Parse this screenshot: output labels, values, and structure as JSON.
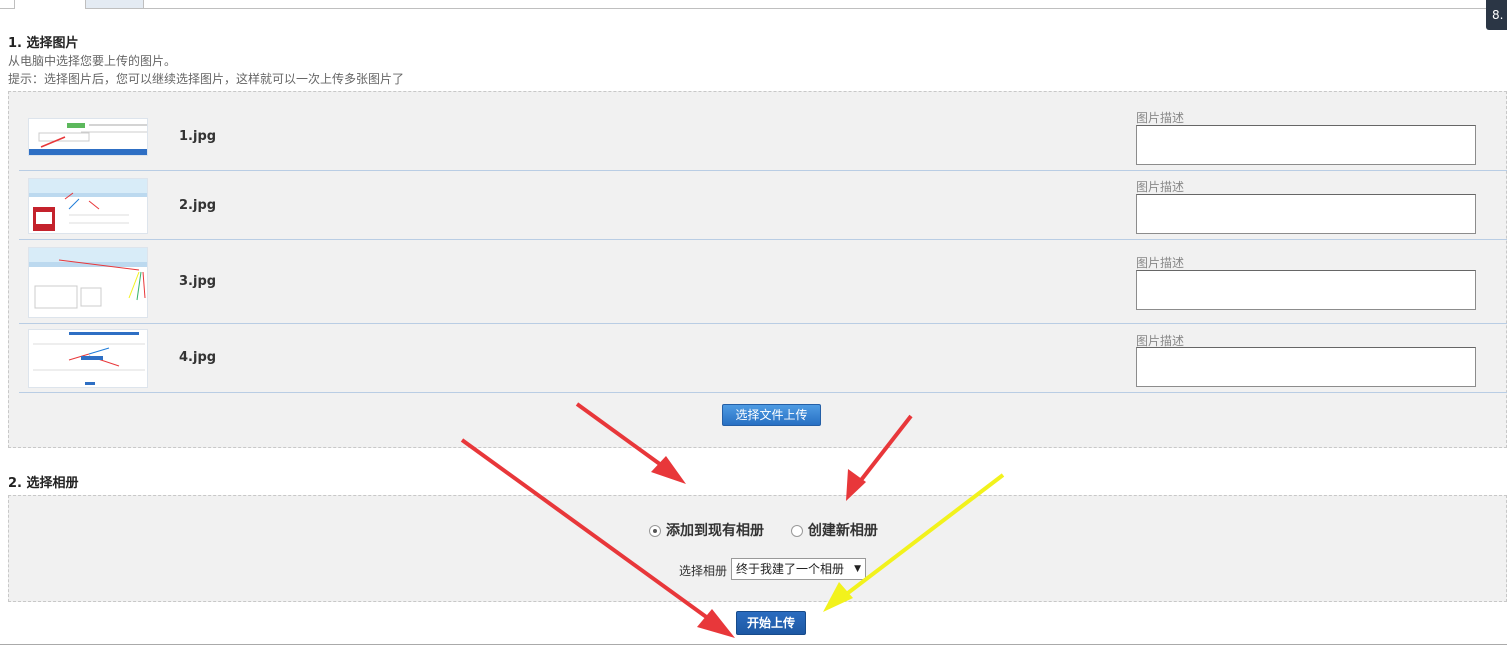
{
  "corner_badge": "8.",
  "section1": {
    "title": "1. 选择图片",
    "help_line1": "从电脑中选择您要上传的图片。",
    "help_line2": "提示：选择图片后，您可以继续选择图片，这样就可以一次上传多张图片了"
  },
  "images": [
    {
      "filename": "1.jpg",
      "desc_label": "图片描述",
      "desc_value": ""
    },
    {
      "filename": "2.jpg",
      "desc_label": "图片描述",
      "desc_value": ""
    },
    {
      "filename": "3.jpg",
      "desc_label": "图片描述",
      "desc_value": ""
    },
    {
      "filename": "4.jpg",
      "desc_label": "图片描述",
      "desc_value": ""
    }
  ],
  "select_file_button": "选择文件上传",
  "section2": {
    "title": "2. 选择相册",
    "radio_existing": "添加到现有相册",
    "radio_new": "创建新相册",
    "selected_radio": "existing",
    "album_label": "选择相册",
    "album_selected": "终于我建了一个相册"
  },
  "start_upload_button": "开始上传",
  "colors": {
    "annotation_red": "#e8373a",
    "annotation_yellow": "#f2f21c",
    "button_blue": "#2a6cc0"
  }
}
